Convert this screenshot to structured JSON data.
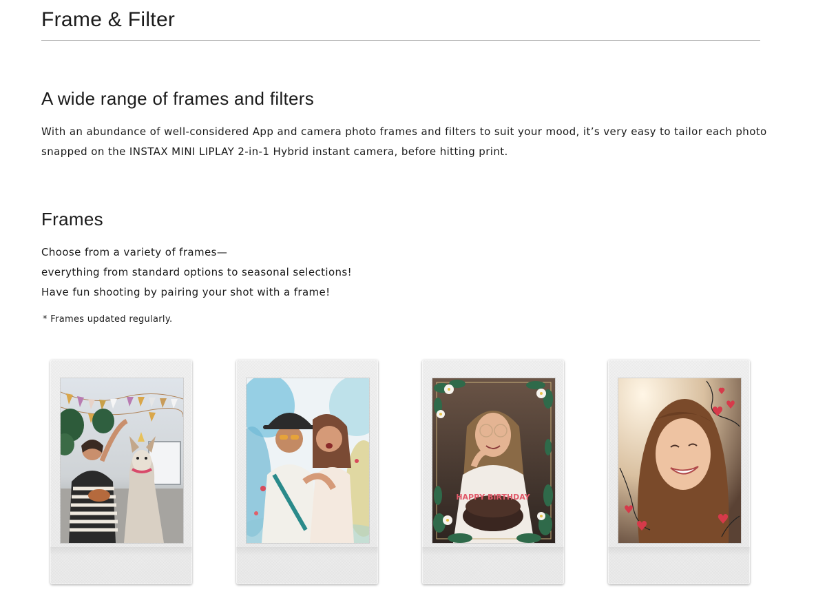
{
  "page": {
    "title": "Frame & Filter"
  },
  "intro": {
    "heading": "A wide range of frames and filters",
    "body": "With an abundance of well-considered App and camera photo frames and filters to suit your mood, it’s very easy to tailor each photo snapped on the INSTAX MINI LIPLAY 2-in-1 Hybrid instant camera, before hitting print."
  },
  "frames": {
    "heading": "Frames",
    "lines": [
      "Choose from a variety of frames—",
      "everything from standard options to seasonal selections!",
      "Have fun shooting by pairing your shot with a frame!"
    ],
    "note": "* Frames updated regularly.",
    "examples": [
      {
        "icon": "party-bunting-frame-photo"
      },
      {
        "icon": "watercolor-splash-frame-photo"
      },
      {
        "icon": "flower-wreath-frame-photo",
        "cake_text": "HAPPY BIRTHDAY"
      },
      {
        "icon": "hearts-doodle-frame-photo"
      }
    ]
  }
}
